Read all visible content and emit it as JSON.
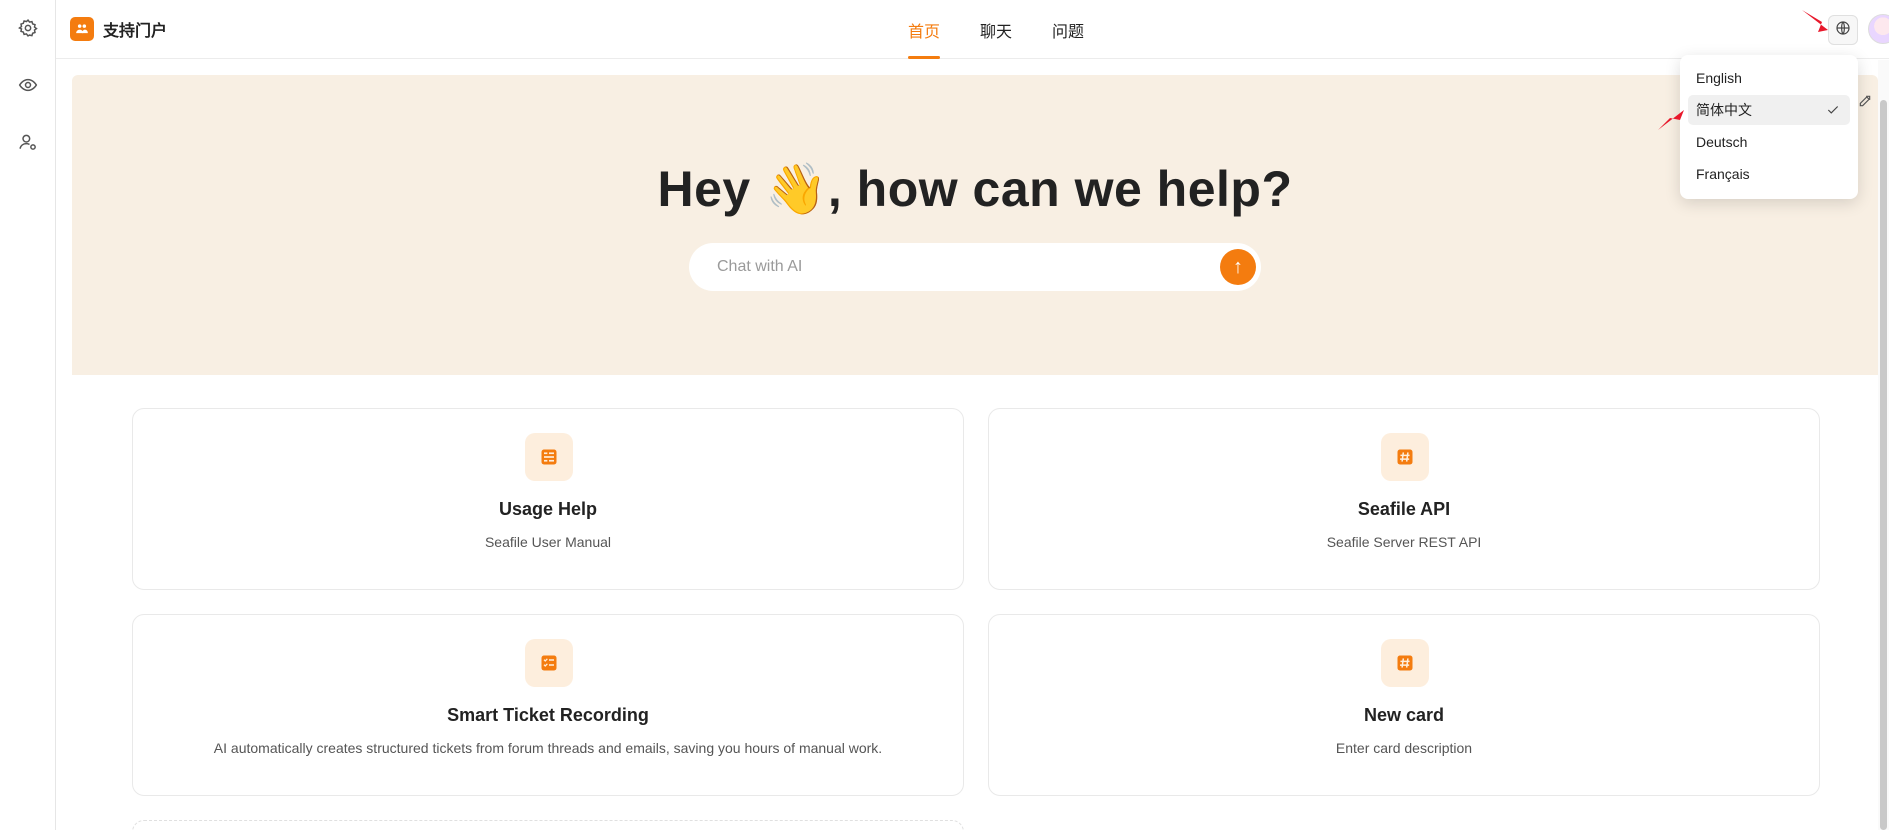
{
  "app": {
    "brand_name": "支持门户"
  },
  "nav": {
    "tabs": [
      {
        "label": "首页",
        "active": true
      },
      {
        "label": "聊天",
        "active": false
      },
      {
        "label": "问题",
        "active": false
      }
    ]
  },
  "rail": {
    "icons": [
      "gear-icon",
      "eye-icon",
      "user-icon"
    ]
  },
  "hero": {
    "title_before": "Hey ",
    "title_emoji": "👋",
    "title_after": ", how can we help?",
    "search_placeholder": "Chat with AI",
    "send_glyph": "↑"
  },
  "cards": [
    {
      "icon": "list-icon",
      "title": "Usage Help",
      "description": "Seafile User Manual"
    },
    {
      "icon": "hash-icon",
      "title": "Seafile API",
      "description": "Seafile Server REST API"
    },
    {
      "icon": "checklist-icon",
      "title": "Smart Ticket Recording",
      "description": "AI automatically creates structured tickets from forum threads and emails, saving you hours of manual work."
    },
    {
      "icon": "hash-icon",
      "title": "New card",
      "description": "Enter card description"
    }
  ],
  "language_menu": {
    "items": [
      {
        "label": "English",
        "selected": false
      },
      {
        "label": "简体中文",
        "selected": true
      },
      {
        "label": "Deutsch",
        "selected": false
      },
      {
        "label": "Français",
        "selected": false
      }
    ]
  },
  "colors": {
    "accent": "#f47c0f",
    "hero_bg": "#f8efe3",
    "icon_bg": "#fdeedd",
    "annotation_arrow": "#e8182b"
  }
}
